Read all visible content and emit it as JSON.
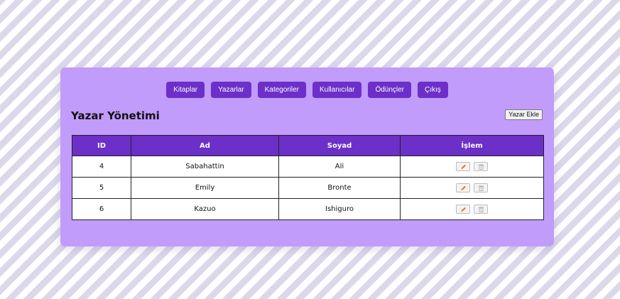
{
  "nav": {
    "items": [
      "Kitaplar",
      "Yazarlar",
      "Kategoriler",
      "Kullanıcılar",
      "Ödünçler",
      "Çıkış"
    ]
  },
  "page": {
    "title": "Yazar Yönetimi",
    "add_button": "Yazar Ekle"
  },
  "table": {
    "headers": [
      "ID",
      "Ad",
      "Soyad",
      "İşlem"
    ],
    "rows": [
      {
        "id": "4",
        "ad": "Sabahattin",
        "soyad": "Ali"
      },
      {
        "id": "5",
        "ad": "Emily",
        "soyad": "Bronte"
      },
      {
        "id": "6",
        "ad": "Kazuo",
        "soyad": "Ishiguro"
      }
    ],
    "actions": {
      "edit_icon": "pencil-icon",
      "delete_icon": "trash-icon"
    }
  },
  "colors": {
    "panel": "#c19cfb",
    "accent": "#6d2fc9",
    "edit_icon": "#f0731f",
    "delete_icon": "#b0b0b0"
  }
}
